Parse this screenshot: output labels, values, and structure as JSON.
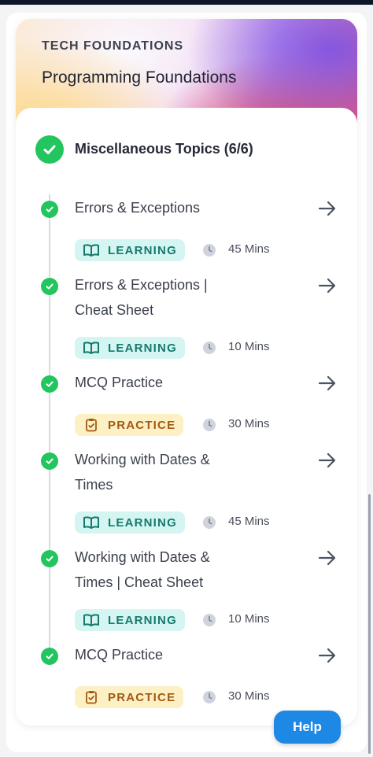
{
  "header": {
    "eyebrow": "TECH FOUNDATIONS",
    "title": "Programming Foundations"
  },
  "section": {
    "title": "Miscellaneous Topics (6/6)",
    "completed": 6,
    "total": 6
  },
  "items": [
    {
      "line1": "Errors & Exceptions",
      "line2": "",
      "type": "LEARNING",
      "type_icon": "book-icon",
      "duration": "45 Mins",
      "completed": true
    },
    {
      "line1": "Errors & Exceptions |",
      "line2": "Cheat Sheet",
      "type": "LEARNING",
      "type_icon": "book-icon",
      "duration": "10 Mins",
      "completed": true
    },
    {
      "line1": "MCQ Practice",
      "line2": "",
      "type": "PRACTICE",
      "type_icon": "clipboard-icon",
      "duration": "30 Mins",
      "completed": true
    },
    {
      "line1": "Working with Dates &",
      "line2": "Times",
      "type": "LEARNING",
      "type_icon": "book-icon",
      "duration": "45 Mins",
      "completed": true
    },
    {
      "line1": "Working with Dates &",
      "line2": "Times | Cheat Sheet",
      "type": "LEARNING",
      "type_icon": "book-icon",
      "duration": "10 Mins",
      "completed": true
    },
    {
      "line1": "MCQ Practice",
      "line2": "",
      "type": "PRACTICE",
      "type_icon": "clipboard-icon",
      "duration": "30 Mins",
      "completed": true
    }
  ],
  "help_button": {
    "label": "Help"
  },
  "colors": {
    "check_green": "#22c55e",
    "learning_bg": "#d4f5f1",
    "learning_text": "#157a6e",
    "practice_bg": "#fdf0c4",
    "practice_text": "#a25a12",
    "help_blue": "#1e88e5"
  }
}
